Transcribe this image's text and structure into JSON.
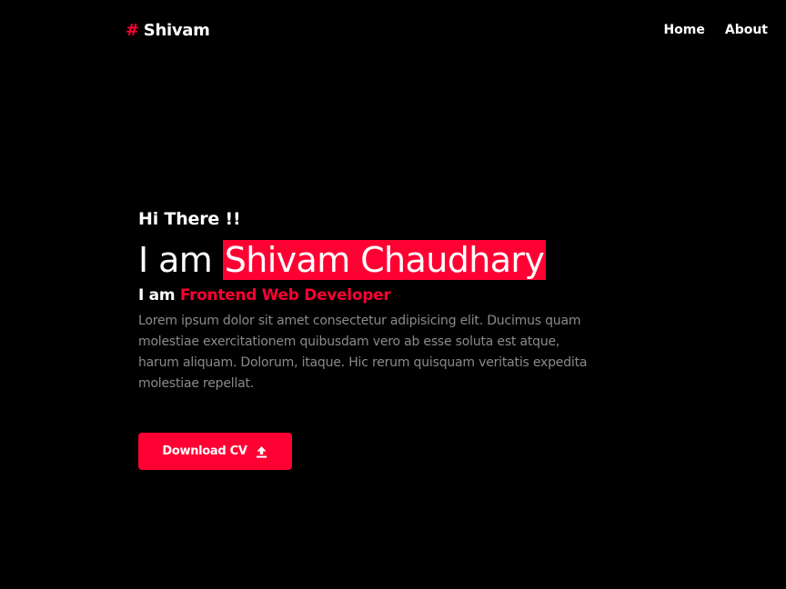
{
  "header": {
    "brand_symbol": "#",
    "brand_name": "Shivam",
    "nav": [
      {
        "label": "Home"
      },
      {
        "label": "About"
      }
    ]
  },
  "hero": {
    "greeting": "Hi There !!",
    "title_prefix": "I am",
    "name": "Shivam Chaudhary",
    "role_prefix": "I am",
    "role": "Frontend Web Developer",
    "description": "Lorem ipsum dolor sit amet consectetur adipisicing elit. Ducimus quam molestiae exercitationem quibusdam vero ab esse soluta est atque, harum aliquam. Dolorum, itaque. Hic rerum quisquam veritatis expedita molestiae repellat.",
    "button_label": "Download CV",
    "button_icon": "upload-icon"
  },
  "colors": {
    "background": "#000000",
    "accent": "#ff0033",
    "text": "#ffffff",
    "muted": "#8a8a8a"
  }
}
